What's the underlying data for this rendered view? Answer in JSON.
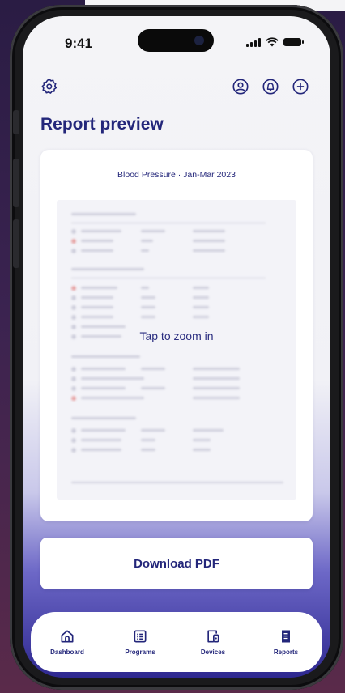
{
  "status_bar": {
    "time": "9:41"
  },
  "header": {
    "settings_icon": "gear-icon",
    "profile_icon": "user-circle-icon",
    "notifications_icon": "bell-icon",
    "add_icon": "plus-circle-icon"
  },
  "page": {
    "title": "Report preview"
  },
  "report": {
    "heading": "Blood Pressure · Jan-Mar 2023",
    "zoom_hint": "Tap to zoom in"
  },
  "actions": {
    "download_label": "Download PDF"
  },
  "tabs": [
    {
      "label": "Dashboard",
      "icon": "home-icon"
    },
    {
      "label": "Programs",
      "icon": "list-icon"
    },
    {
      "label": "Devices",
      "icon": "devices-icon"
    },
    {
      "label": "Reports",
      "icon": "document-icon"
    }
  ],
  "colors": {
    "primary": "#23267a",
    "accent_gradient_bottom": "#2e2890",
    "background": "#f4f4f7"
  }
}
